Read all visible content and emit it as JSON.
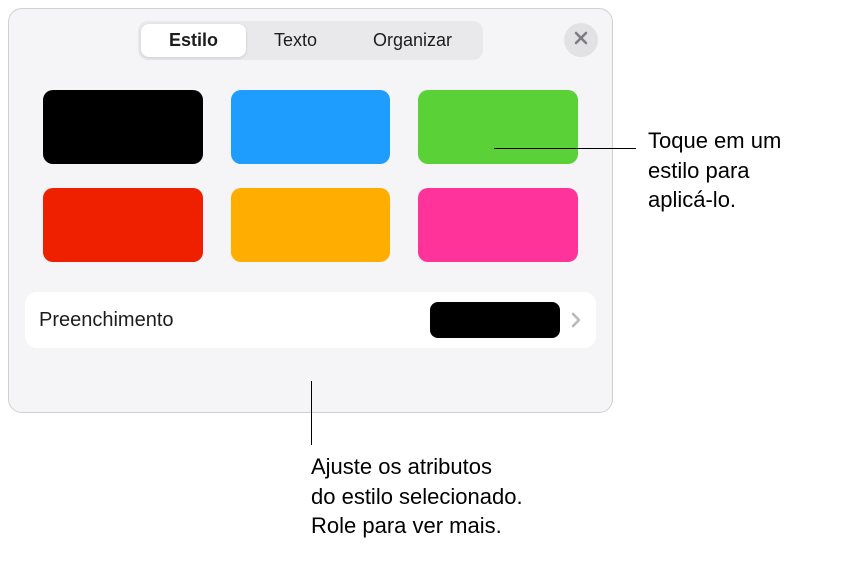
{
  "tabs": {
    "style": "Estilo",
    "text": "Texto",
    "arrange": "Organizar"
  },
  "swatches": [
    {
      "name": "black",
      "color": "#000000"
    },
    {
      "name": "blue",
      "color": "#1e9dff"
    },
    {
      "name": "green",
      "color": "#5ad237"
    },
    {
      "name": "red",
      "color": "#ee2000"
    },
    {
      "name": "orange",
      "color": "#ffae00"
    },
    {
      "name": "magenta",
      "color": "#ff3399"
    }
  ],
  "fill": {
    "label": "Preenchimento",
    "currentColor": "#000000"
  },
  "callouts": {
    "tapStyle": "Toque em um\nestilo para\naplicá-lo.",
    "adjustAttrs": "Ajuste os atributos\ndo estilo selecionado.\nRole para ver mais."
  }
}
